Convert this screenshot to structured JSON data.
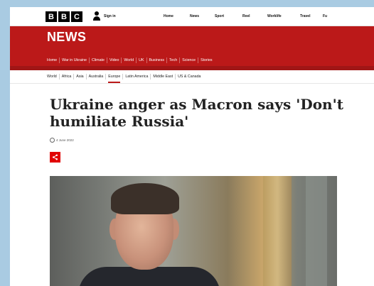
{
  "topbar": {
    "logo": [
      "B",
      "B",
      "C"
    ],
    "signin_label": "Sign in",
    "nav": [
      "Home",
      "News",
      "Sport",
      "Reel",
      "Worklife",
      "Travel",
      "Fu"
    ]
  },
  "news": {
    "title": "NEWS",
    "nav": [
      "Home",
      "War in Ukraine",
      "Climate",
      "Video",
      "World",
      "UK",
      "Business",
      "Tech",
      "Science",
      "Stories"
    ]
  },
  "subnav": {
    "items": [
      "World",
      "Africa",
      "Asia",
      "Australia",
      "Europe",
      "Latin America",
      "Middle East",
      "US & Canada"
    ],
    "active": "Europe"
  },
  "article": {
    "headline": "Ukraine anger as Macron says 'Don't humiliate Russia'",
    "date": "4 June 2022",
    "share_icon": "share-icon"
  },
  "colors": {
    "brand_red": "#bb1919",
    "share_red": "#e10000",
    "background": "#a9cbe2"
  }
}
